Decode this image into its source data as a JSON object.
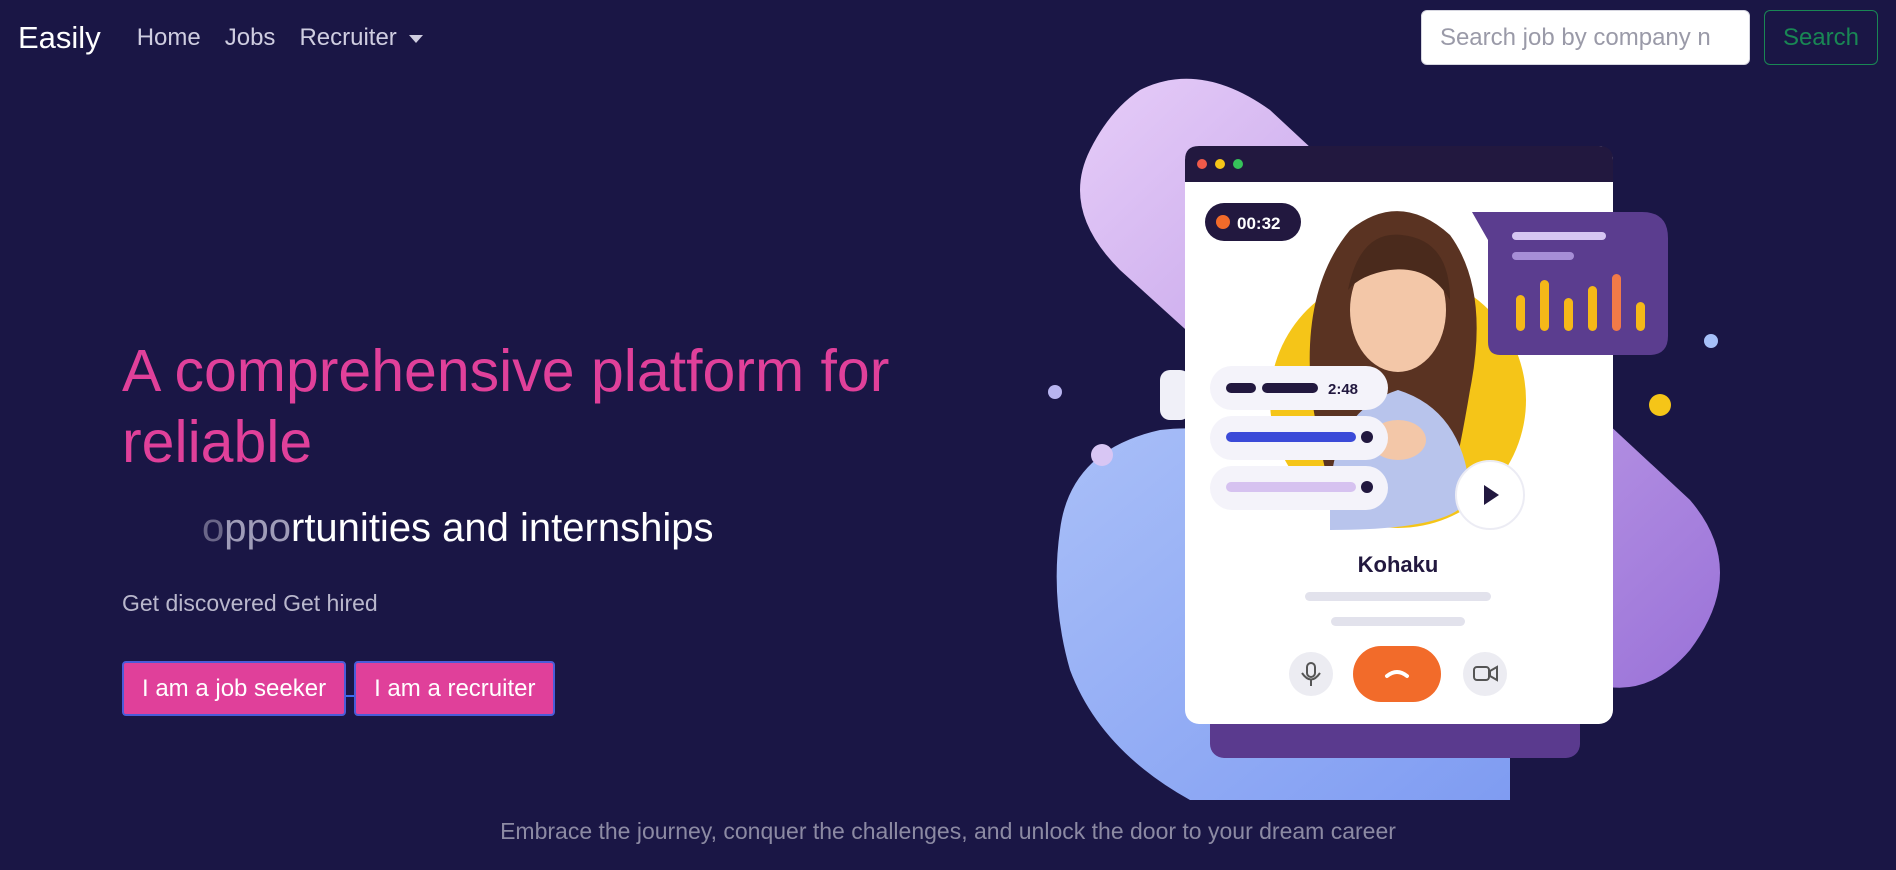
{
  "navbar": {
    "brand": "Easily",
    "links": [
      {
        "label": "Home"
      },
      {
        "label": "Jobs"
      },
      {
        "label": "Recruiter"
      }
    ],
    "search": {
      "placeholder": "Search job by company n",
      "value": "",
      "button_label": "Search"
    }
  },
  "hero": {
    "title": "A comprehensive platform for reliable",
    "subtitle": {
      "ghost_leading": "o",
      "faded": "ppo",
      "visible": "rtunities and internships"
    },
    "tagline": "Get discovered Get hired",
    "buttons": {
      "seeker": "I am a job seeker",
      "recruiter": "I am a recruiter"
    }
  },
  "illustration": {
    "call_timer": "00:32",
    "audio_length": "2:48",
    "caller_name": "Kohaku"
  },
  "footer": {
    "text": "Embrace the journey, conquer the challenges, and unlock the door to your dream career"
  },
  "colors": {
    "background": "#1a1645",
    "accent_pink": "#e0409a",
    "search_green": "#198754",
    "end_call_orange": "#f26b2a"
  }
}
